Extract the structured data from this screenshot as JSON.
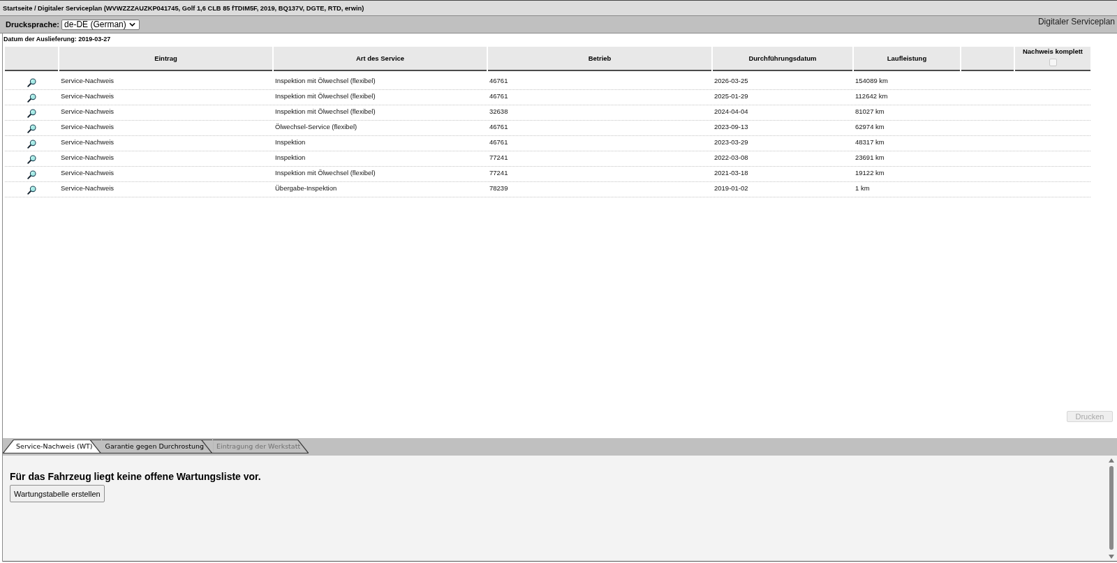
{
  "breadcrumb": "Startseite / Digitaler Serviceplan (WVWZZZAUZKP041745, Golf 1,6 CLB 85 fTDIM5F, 2019, BQ137V, DGTE, RTD, erwin)",
  "toolbar": {
    "label": "Drucksprache:",
    "language_select": {
      "value": "de-DE (German)"
    },
    "title": "Digitaler Serviceplan"
  },
  "delivery_date": "Datum der Auslieferung: 2019-03-27",
  "table": {
    "columns": [
      {
        "label": "Eintrag"
      },
      {
        "label": "Art des Service"
      },
      {
        "label": "Betrieb"
      },
      {
        "label": "Durchführungsdatum"
      },
      {
        "label": "Laufleistung"
      }
    ],
    "complete_column": {
      "label": "Nachweis komplett",
      "checkbox": {
        "checked": false,
        "disabled": true
      }
    },
    "rows": [
      {
        "entry": "Service-Nachweis",
        "service_type": "Inspektion mit Ölwechsel (flexibel)",
        "workshop": "46761",
        "date": "2026-03-25",
        "mileage": "154089 km"
      },
      {
        "entry": "Service-Nachweis",
        "service_type": "Inspektion mit Ölwechsel (flexibel)",
        "workshop": "46761",
        "date": "2025-01-29",
        "mileage": "112642 km"
      },
      {
        "entry": "Service-Nachweis",
        "service_type": "Inspektion mit Ölwechsel (flexibel)",
        "workshop": "32638",
        "date": "2024-04-04",
        "mileage": "81027 km"
      },
      {
        "entry": "Service-Nachweis",
        "service_type": "Ölwechsel-Service (flexibel)",
        "workshop": "46761",
        "date": "2023-09-13",
        "mileage": "62974 km"
      },
      {
        "entry": "Service-Nachweis",
        "service_type": "Inspektion",
        "workshop": "46761",
        "date": "2023-03-29",
        "mileage": "48317 km"
      },
      {
        "entry": "Service-Nachweis",
        "service_type": "Inspektion",
        "workshop": "77241",
        "date": "2022-03-08",
        "mileage": "23691 km"
      },
      {
        "entry": "Service-Nachweis",
        "service_type": "Inspektion mit Ölwechsel (flexibel)",
        "workshop": "77241",
        "date": "2021-03-18",
        "mileage": "19122 km"
      },
      {
        "entry": "Service-Nachweis",
        "service_type": "Übergabe-Inspektion",
        "workshop": "78239",
        "date": "2019-01-02",
        "mileage": "1 km"
      }
    ]
  },
  "print_button": {
    "label": "Drucken",
    "disabled": true
  },
  "tabs": [
    {
      "label": "Service-Nachweis (WT)",
      "selected": true,
      "disabled": false
    },
    {
      "label": "Garantie gegen Durchrostung",
      "selected": false,
      "disabled": false
    },
    {
      "label": "Eintragung der Werkstatt",
      "selected": false,
      "disabled": true
    }
  ],
  "panel": {
    "message": "Für das Fahrzeug liegt keine offene Wartungsliste vor.",
    "button": "Wartungstabelle erstellen"
  }
}
